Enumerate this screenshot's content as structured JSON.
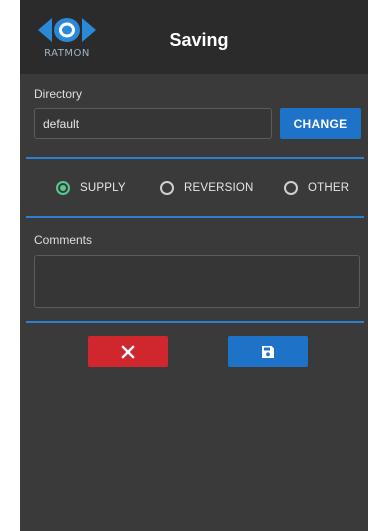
{
  "header": {
    "logo_text": "RATMON",
    "title": "Saving"
  },
  "directory": {
    "label": "Directory",
    "value": "default",
    "change_label": "CHANGE"
  },
  "type_options": [
    {
      "label": "SUPPLY",
      "checked": true
    },
    {
      "label": "REVERSION",
      "checked": false
    },
    {
      "label": "OTHER",
      "checked": false
    }
  ],
  "comments": {
    "label": "Comments",
    "value": ""
  },
  "actions": {
    "cancel_icon": "close-icon",
    "save_icon": "floppy-disk-icon"
  },
  "colors": {
    "panel_bg": "#3a3a3a",
    "header_bg": "#2b2b2b",
    "accent_blue": "#1e73c9",
    "divider_blue": "#2d7fd1",
    "cancel_red": "#d0262e",
    "radio_green": "#56c98f"
  }
}
